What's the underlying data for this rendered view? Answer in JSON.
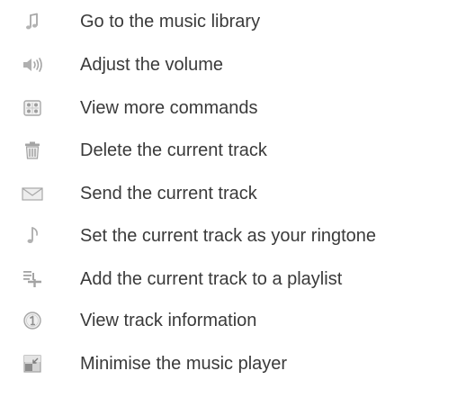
{
  "legend": {
    "items": [
      {
        "icon": "music-note-icon",
        "label": "Go to the music library"
      },
      {
        "icon": "volume-icon",
        "label": "Adjust the volume"
      },
      {
        "icon": "more-commands-icon",
        "label": "View more commands"
      },
      {
        "icon": "trash-icon",
        "label": "Delete the current track"
      },
      {
        "icon": "envelope-icon",
        "label": "Send the current track"
      },
      {
        "icon": "ringtone-icon",
        "label": "Set the current track as your ringtone"
      },
      {
        "icon": "add-to-playlist-icon",
        "label": "Add the current track to a playlist"
      },
      {
        "icon": "info-icon",
        "label": "View track information"
      },
      {
        "icon": "minimise-icon",
        "label": "Minimise the music player"
      }
    ]
  }
}
